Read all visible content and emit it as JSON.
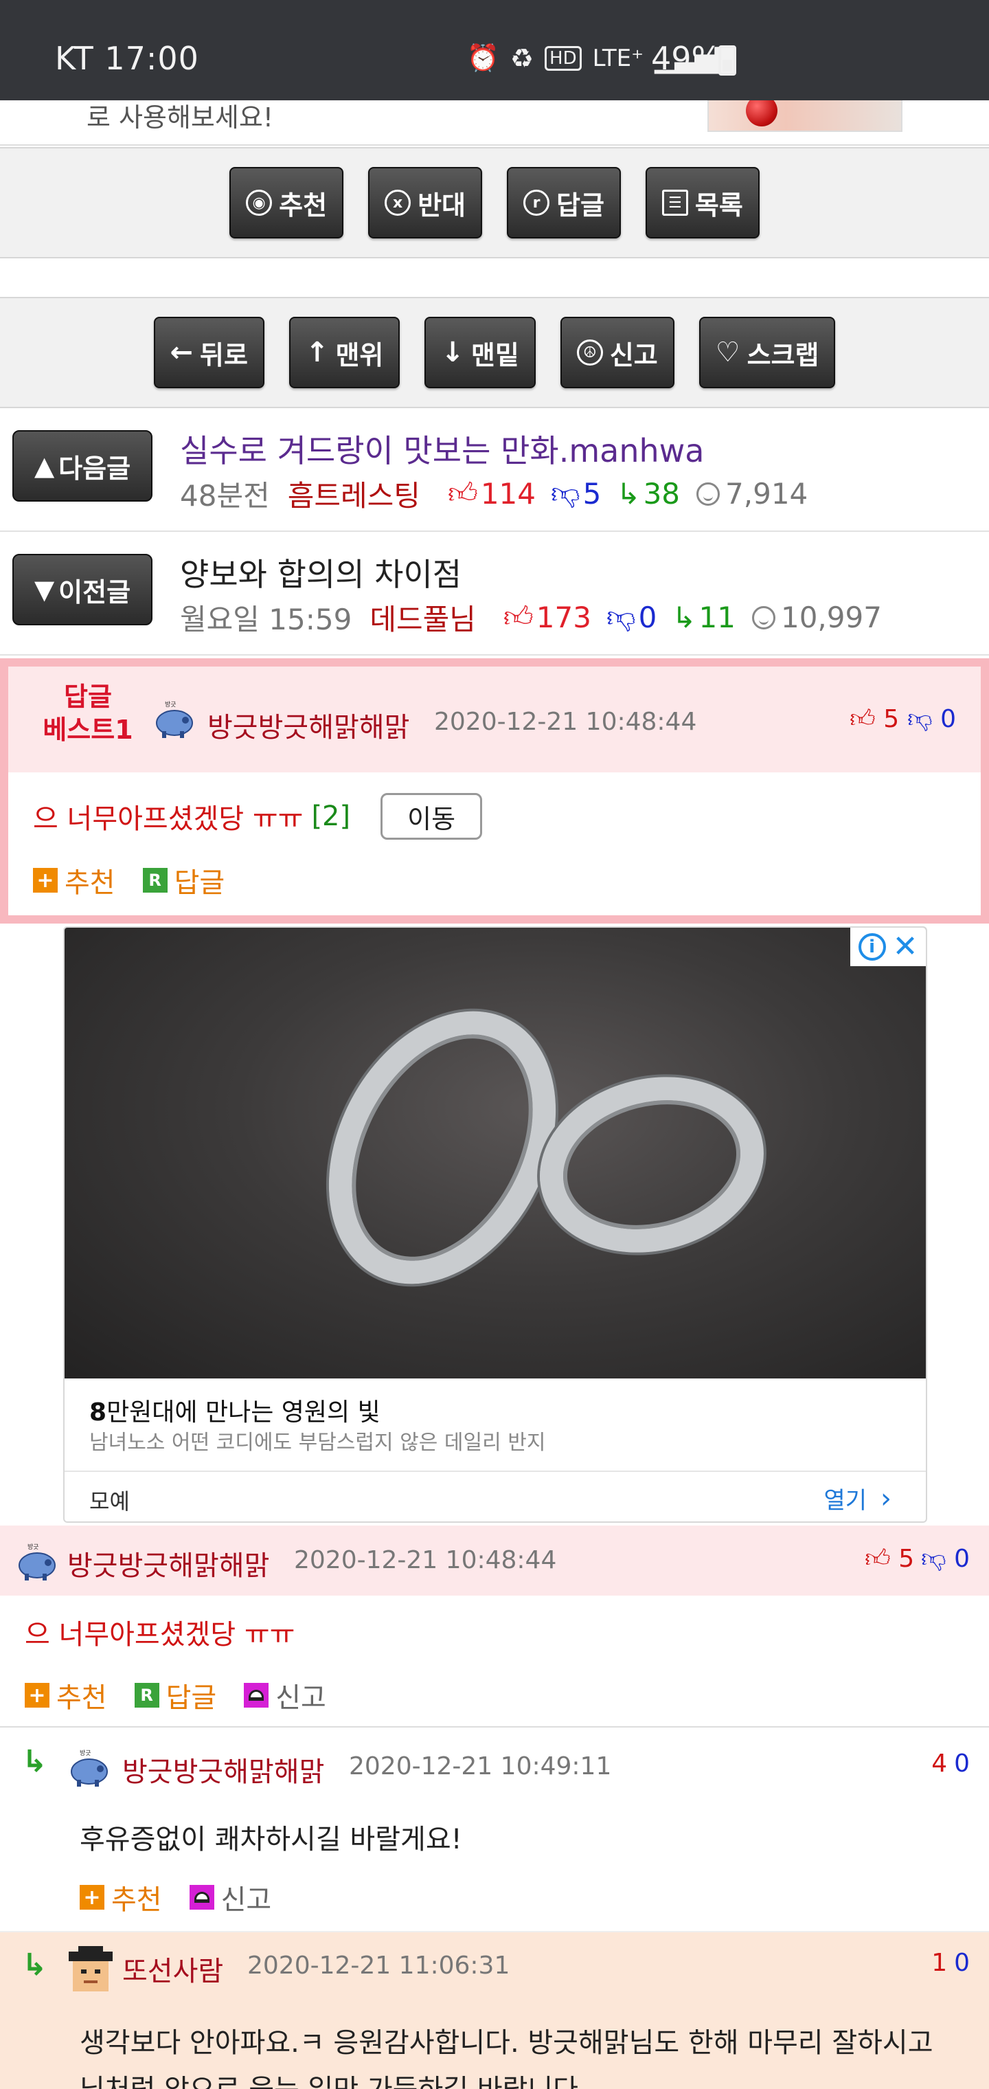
{
  "status_bar": {
    "carrier": "KT 17:00",
    "battery": "49%",
    "icons": [
      "alarm-icon",
      "recycle-icon",
      "hd-icon",
      "lte-icon",
      "signal-icon"
    ]
  },
  "top_strip": {
    "text": "로 사용해보세요!"
  },
  "toolbar1": {
    "recommend": "추천",
    "oppose": "반대",
    "reply": "답글",
    "list": "목록"
  },
  "toolbar2": {
    "back": "뒤로",
    "top": "맨위",
    "bottom": "맨밑",
    "report": "신고",
    "scrap": "스크랩"
  },
  "next_post": {
    "button": "다음글",
    "title": "실수로 겨드랑이 맛보는 만화.manhwa",
    "time": "48분전",
    "author": "흠트레스팅",
    "up": "114",
    "down": "5",
    "replies": "38",
    "views": "7,914"
  },
  "prev_post": {
    "button": "이전글",
    "title": "양보와 합의의 차이점",
    "time": "월요일 15:59",
    "author": "데드풀님",
    "up": "173",
    "down": "0",
    "replies": "11",
    "views": "10,997"
  },
  "best_reply": {
    "badge_line1": "답글",
    "badge_line2": "베스트1",
    "author": "방긋방긋해맑해맑",
    "date": "2020-12-21 10:48:44",
    "up": "5",
    "down": "0",
    "body": "으 너무아프셨겠당 ㅠㅠ",
    "count": "[2]",
    "move_button": "이동",
    "recommend": "추천",
    "reply": "답글"
  },
  "ad": {
    "title_bold": "8",
    "title_rest": "만원대에 만나는 영원의 빛",
    "description": "남녀노소 어떤 코디에도 부담스럽지 않은 데일리 반지",
    "brand": "모예",
    "open": "열기"
  },
  "comments": [
    {
      "author": "방긋방긋해맑해맑",
      "date": "2020-12-21 10:48:44",
      "up": "5",
      "down": "0",
      "body": "으 너무아프셨겠당 ㅠㅠ",
      "recommend": "추천",
      "reply": "답글",
      "report": "신고"
    },
    {
      "author": "방긋방긋해맑해맑",
      "date": "2020-12-21 10:49:11",
      "up": "4",
      "down": "0",
      "body": "후유증없이 쾌차하시길 바랄게요!",
      "recommend": "추천",
      "report": "신고"
    },
    {
      "author": "또선사람",
      "date": "2020-12-21 11:06:31",
      "up": "1",
      "down": "0",
      "body_line1": "생각보다 안아파요.ㅋ 응원감사합니다. 방긋해맑님도 한해 마무리 잘하시고",
      "body_line2": "님처럼 앞으로 웃는 일만 가득하길 바랍니다."
    }
  ],
  "colors": {
    "status_bar": "#34363a",
    "best_border": "#f8b8bf",
    "best_head_bg": "#fde8ea",
    "comment_highlight_bg": "#fce7d8",
    "up_red": "#e0202a",
    "down_blue": "#1a2ad0",
    "reply_green": "#1a9a1a"
  }
}
